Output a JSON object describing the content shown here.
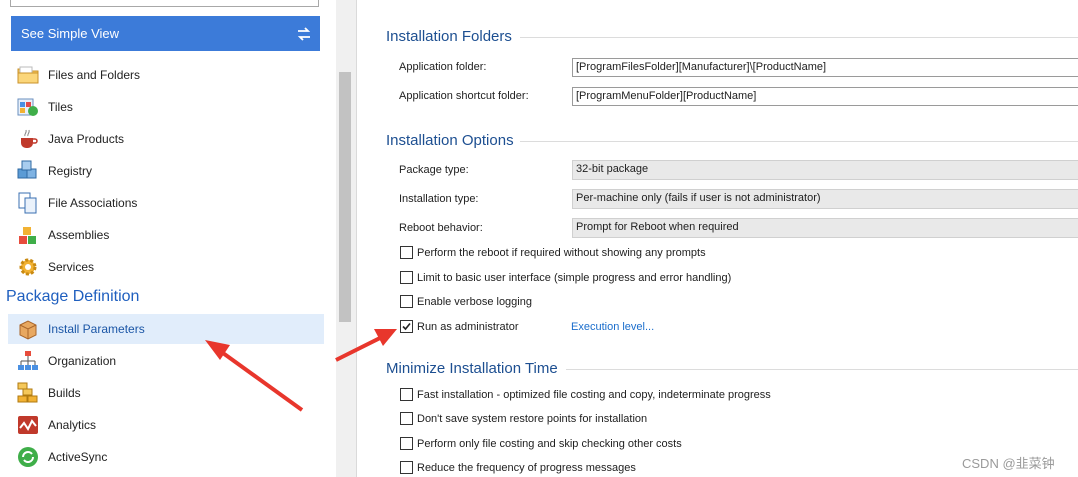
{
  "sidebar": {
    "simple_view_label": "See Simple View",
    "items": [
      {
        "label": "Files and Folders",
        "icon": "folder-icon"
      },
      {
        "label": "Tiles",
        "icon": "tiles-icon"
      },
      {
        "label": "Java Products",
        "icon": "java-cup-icon"
      },
      {
        "label": "Registry",
        "icon": "registry-cubes-icon"
      },
      {
        "label": "File Associations",
        "icon": "file-associations-icon"
      },
      {
        "label": "Assemblies",
        "icon": "assemblies-icon"
      },
      {
        "label": "Services",
        "icon": "services-gear-icon"
      }
    ],
    "section_title": "Package Definition",
    "package_items": [
      {
        "label": "Install Parameters",
        "icon": "install-parameters-box-icon",
        "selected": true
      },
      {
        "label": "Organization",
        "icon": "organization-chart-icon"
      },
      {
        "label": "Builds",
        "icon": "builds-bricks-icon"
      },
      {
        "label": "Analytics",
        "icon": "analytics-icon"
      },
      {
        "label": "ActiveSync",
        "icon": "activesync-icon"
      }
    ]
  },
  "folders": {
    "title": "Installation Folders",
    "application_folder_label": "Application folder:",
    "application_folder_value": "[ProgramFilesFolder][Manufacturer]\\[ProductName]",
    "shortcut_folder_label": "Application shortcut folder:",
    "shortcut_folder_value": "[ProgramMenuFolder][ProductName]"
  },
  "options": {
    "title": "Installation Options",
    "package_type_label": "Package type:",
    "package_type_value": "32-bit package",
    "installation_type_label": "Installation type:",
    "installation_type_value": "Per-machine only (fails if user is not administrator)",
    "reboot_label": "Reboot behavior:",
    "reboot_value": "Prompt for Reboot when required",
    "checkboxes": [
      {
        "label": "Perform the reboot if required without showing any prompts",
        "checked": false
      },
      {
        "label": "Limit to basic user interface (simple progress and error handling)",
        "checked": false
      },
      {
        "label": "Enable verbose logging",
        "checked": false
      },
      {
        "label": "Run as administrator",
        "checked": true
      }
    ],
    "execution_level_link": "Execution level..."
  },
  "minimize": {
    "title": "Minimize Installation Time",
    "checkboxes": [
      {
        "label": "Fast installation - optimized file costing and copy, indeterminate progress",
        "checked": false
      },
      {
        "label": "Don't save system restore points for installation",
        "checked": false
      },
      {
        "label": "Perform only file costing and skip checking other costs",
        "checked": false
      },
      {
        "label": "Reduce the frequency of progress messages",
        "checked": false
      }
    ]
  },
  "watermark": "CSDN @韭菜钟",
  "colors": {
    "accent": "#3c7bd9",
    "heading": "#1d4f91",
    "annotation_arrow": "#e8362c"
  }
}
